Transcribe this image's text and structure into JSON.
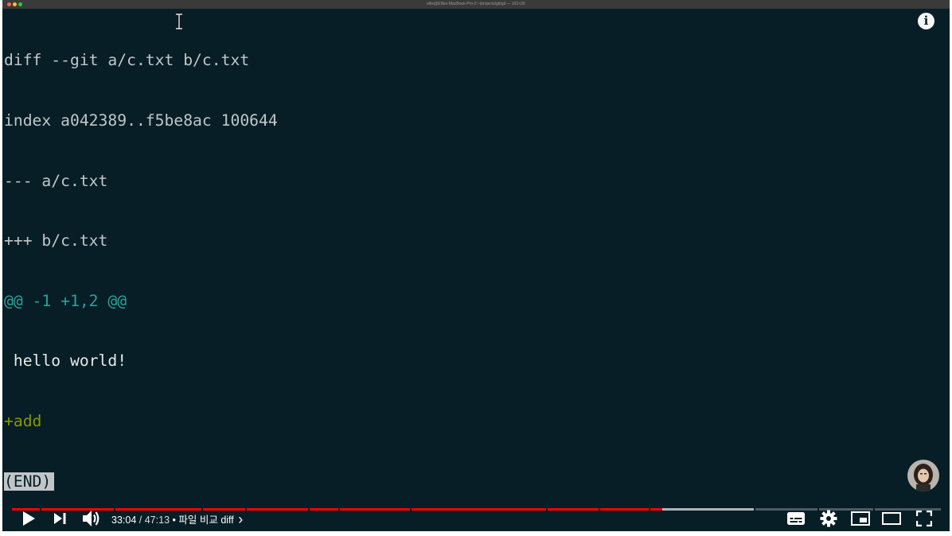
{
  "window": {
    "title": "ellie@Ellies-MacBook-Pro-2:~/projects/git/git — 101×26"
  },
  "terminal": {
    "lines": [
      {
        "text": "diff --git a/c.txt b/c.txt",
        "style": "default"
      },
      {
        "text": "index a042389..f5be8ac 100644",
        "style": "default"
      },
      {
        "text": "--- a/c.txt",
        "style": "default"
      },
      {
        "text": "+++ b/c.txt",
        "style": "default"
      },
      {
        "text": "@@ -1 +1,2 @@",
        "style": "hunk"
      },
      {
        "text": " hello world!",
        "style": "context"
      },
      {
        "text": "+add",
        "style": "added"
      }
    ],
    "pager_status": "(END)",
    "colors": {
      "background": "#071e26",
      "text": "#c0c6c8",
      "hunk": "#2aa198",
      "added": "#859900"
    }
  },
  "player": {
    "current_time": "33:04",
    "separator": "/",
    "duration": "47:13",
    "chapter_bullet": "•",
    "chapter_title": "파일 비교 diff",
    "chapter_arrow": "›",
    "progress_played_fraction": 0.7,
    "progress_buffered_fraction": 0.8,
    "accent_color": "#ff0000",
    "icons": [
      "play-icon",
      "next-icon",
      "volume-icon",
      "subtitles-icon",
      "settings-icon",
      "miniplayer-icon",
      "theater-icon",
      "fullscreen-icon",
      "info-icon"
    ]
  }
}
